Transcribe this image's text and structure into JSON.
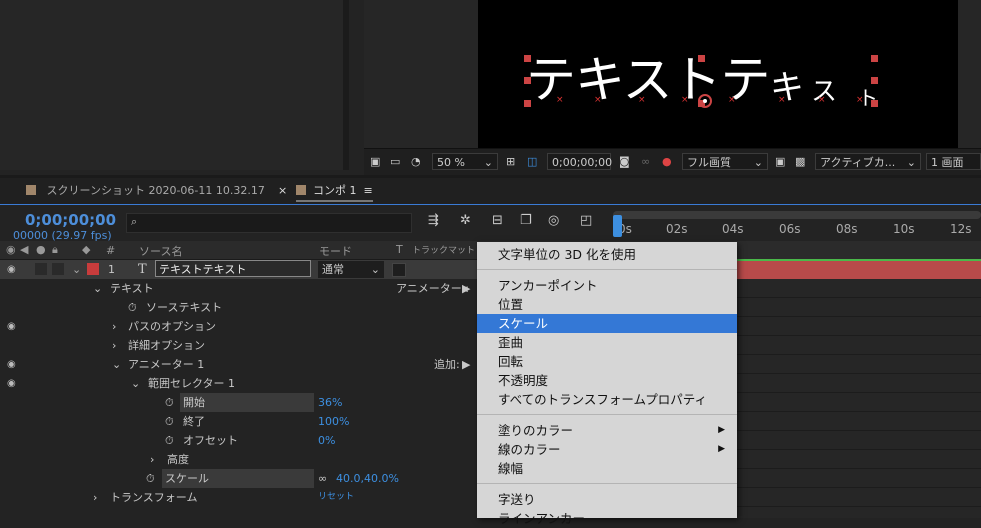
{
  "viewer": {
    "comp_text_large": "テキストテ",
    "comp_text_small": [
      "キ",
      "ス",
      "ト"
    ],
    "zoom": "50 %",
    "timecode": "0;00;00;00",
    "resolution": "フル画質",
    "view": "アクティブカ...",
    "layout": "1 画面"
  },
  "tabs": [
    {
      "label": "スクリーンショット 2020-06-11 10.32.17"
    },
    {
      "label": "コンポ 1"
    }
  ],
  "timeline": {
    "time": "0;00;00;00",
    "fps": "00000 (29.97 fps)",
    "search_placeholder": "",
    "ruler_labels": [
      "0s",
      "02s",
      "04s",
      "06s",
      "08s",
      "10s",
      "12s"
    ],
    "headers": {
      "hash": "#",
      "source": "ソース名",
      "mode": "モード",
      "t": "T",
      "trackmatte": "トラックマット"
    },
    "layer": {
      "num": "1",
      "type_icon": "T",
      "name": "テキストテキスト",
      "mode": "通常",
      "color": "#c83c3c"
    },
    "rows": {
      "text": "テキスト",
      "animator_label": "アニメーター :",
      "source_text": "ソーステキスト",
      "path_options": "パスのオプション",
      "more_options": "詳細オプション",
      "animator1": "アニメーター 1",
      "add_label": "追加:",
      "range_selector": "範囲セレクター 1",
      "start": "開始",
      "start_value": "36%",
      "end": "終了",
      "end_value": "100%",
      "offset": "オフセット",
      "offset_value": "0%",
      "advanced": "高度",
      "scale": "スケール",
      "scale_value": "40.0,40.0%",
      "transform": "トランスフォーム",
      "reset": "リセット"
    }
  },
  "menu": {
    "items": [
      {
        "label": "文字単位の 3D 化を使用"
      },
      {
        "label": "アンカーポイント"
      },
      {
        "label": "位置"
      },
      {
        "label": "スケール",
        "selected": true
      },
      {
        "label": "歪曲"
      },
      {
        "label": "回転"
      },
      {
        "label": "不透明度"
      },
      {
        "label": "すべてのトランスフォームプロパティ"
      },
      {
        "label": "塗りのカラー"
      },
      {
        "label": "線のカラー"
      },
      {
        "label": "線幅"
      },
      {
        "label": "字送り"
      },
      {
        "label": "ラインアンカー"
      }
    ]
  },
  "colors": {
    "accent": "#3478d6",
    "layer_label": "#c83c3c",
    "timecode": "#4d8ed9",
    "track_bar": "#b84a4a"
  }
}
